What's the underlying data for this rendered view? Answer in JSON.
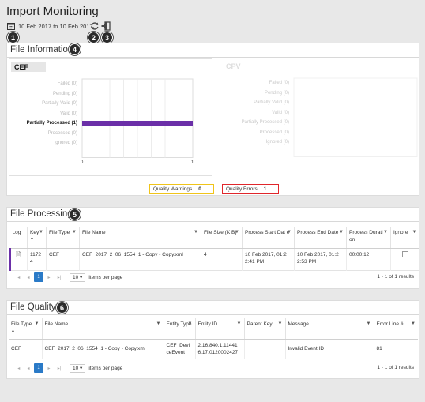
{
  "header": {
    "title": "Import Monitoring",
    "date_range": "10 Feb 2017 to 10 Feb 2017"
  },
  "callouts": [
    "1",
    "2",
    "3",
    "4",
    "5",
    "6"
  ],
  "file_information": {
    "title": "File Information",
    "quality_warnings_label": "Quality Warnings",
    "quality_warnings_value": "0",
    "quality_errors_label": "Quality Errors",
    "quality_errors_value": "1"
  },
  "chart_data": [
    {
      "type": "bar",
      "title": "CEF",
      "orientation": "horizontal",
      "categories": [
        "Failed (0)",
        "Pending (0)",
        "Partially Valid (0)",
        "Valid (0)",
        "Partially Processed (1)",
        "Processed (0)",
        "Ignored (0)"
      ],
      "values": [
        0,
        0,
        0,
        0,
        1,
        0,
        0
      ],
      "xlim": [
        0,
        1
      ],
      "xticks": [
        "0",
        "1"
      ],
      "bar_color": "#6b2fa8",
      "grid": true
    },
    {
      "type": "bar",
      "title": "CPV",
      "orientation": "horizontal",
      "categories": [
        "Failed (0)",
        "Pending (0)",
        "Partially Valid (0)",
        "Valid (0)",
        "Partially Processed (0)",
        "Processed (0)",
        "Ignored (0)"
      ],
      "values": [
        0,
        0,
        0,
        0,
        0,
        0,
        0
      ],
      "grid": false
    }
  ],
  "file_processing": {
    "title": "File Processing",
    "columns": [
      "Log",
      "Key",
      "File Type",
      "File Name",
      "File Size (KB)",
      "Process Start Date",
      "Process End Date",
      "Process Duration",
      "Ignore"
    ],
    "columns_display": [
      "Log",
      "Key",
      "File Type",
      "File Name",
      "File Size (K B)",
      "Process Start Dat e",
      "Process End Date",
      "Process Durati on",
      "Ignore"
    ],
    "rows": [
      {
        "key": "11724",
        "key_display": "1172 4",
        "file_type": "CEF",
        "file_name": "CEF_2017_2_06_1554_1 - Copy - Copy.xml",
        "file_size": "4",
        "start": "10 Feb 2017, 01:2 2:41 PM",
        "end": "10 Feb 2017, 01:2 2:53 PM",
        "duration": "00:00:12"
      }
    ],
    "pager": {
      "page": "1",
      "page_size": "10",
      "items_label": "items per page",
      "summary": "1 - 1 of 1 results"
    }
  },
  "file_quality": {
    "title": "File Quality",
    "columns_display": [
      "File Type",
      "File Name",
      "Entity Type",
      "Entity ID",
      "Parent Key",
      "Message",
      "Error Line #"
    ],
    "rows": [
      {
        "file_type": "CEF",
        "file_name": "CEF_2017_2_06_1554_1 - Copy - Copy.xml",
        "entity_type": "CEF_Devi ceEvent",
        "entity_id": "2.16.840.1.11441 6.17.0120002427",
        "parent_key": "",
        "message": "Invalid Event ID",
        "error_line": "81"
      }
    ],
    "pager": {
      "page": "1",
      "page_size": "10",
      "items_label": "items per page",
      "summary": "1 - 1 of 1 results"
    }
  },
  "colors": {
    "accent_blue": "#2a7ac7",
    "bar_purple": "#6b2fa8",
    "warn_yellow": "#f0c419",
    "error_red": "#e0262b"
  }
}
